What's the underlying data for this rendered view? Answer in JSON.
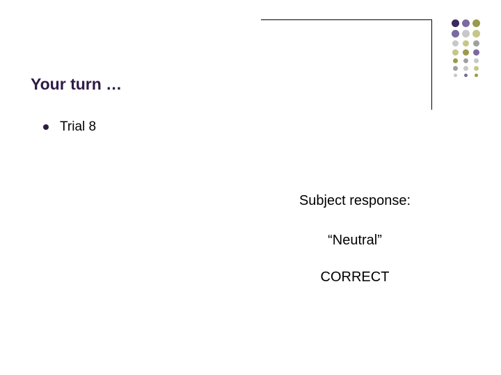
{
  "title": "Your turn …",
  "bullet": {
    "label": "Trial 8"
  },
  "response": {
    "label": "Subject response:",
    "value": "“Neutral”",
    "result": "CORRECT"
  },
  "deco": {
    "colors": {
      "purple_dk": "#3b2a5a",
      "purple_md": "#7a6aa0",
      "olive_dk": "#9a9a4a",
      "olive_lt": "#c6c68a",
      "gray_lt": "#c8c8c8",
      "gray_md": "#a0a0a0"
    }
  }
}
